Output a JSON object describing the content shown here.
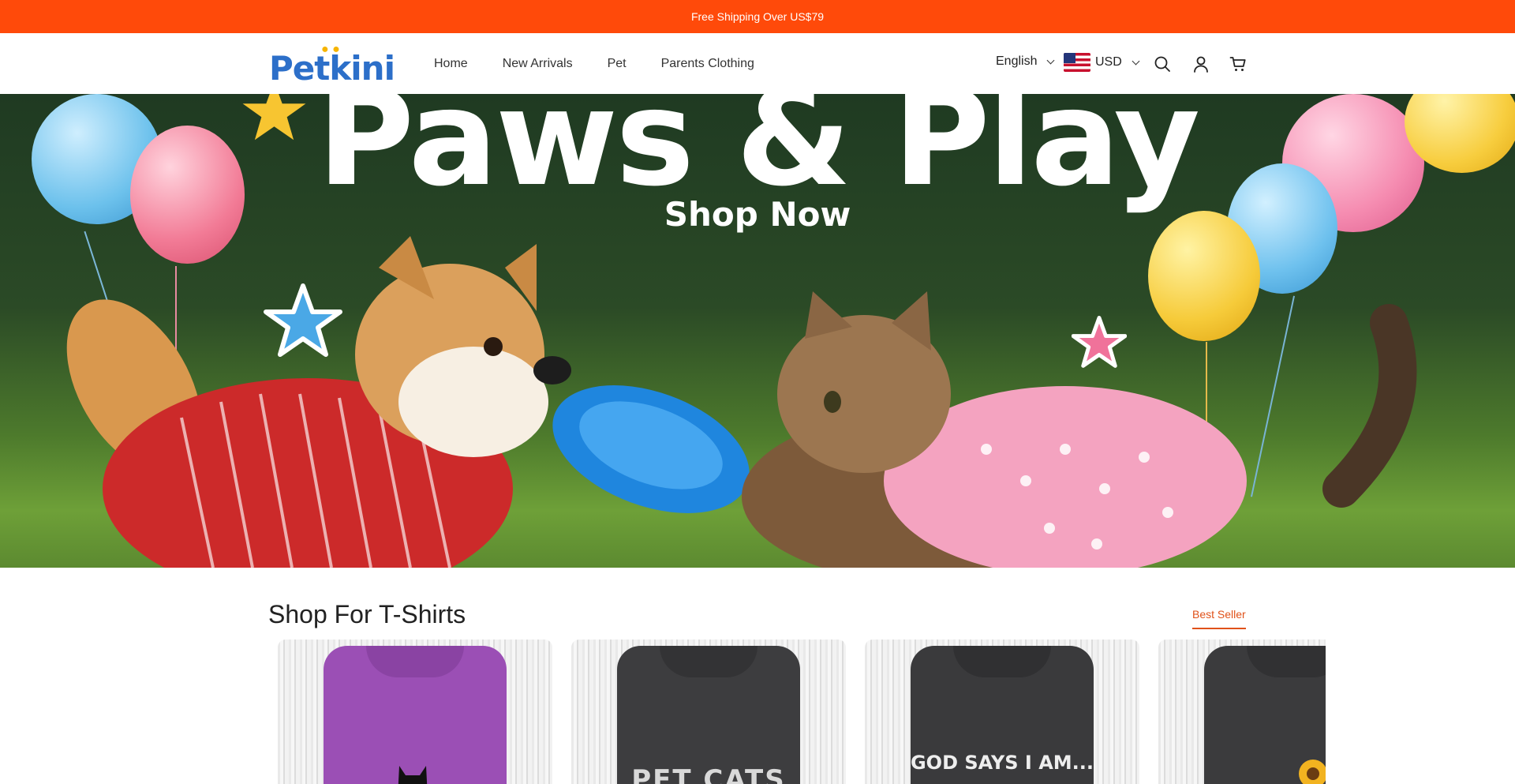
{
  "announcement": {
    "text": "Free Shipping Over US$79"
  },
  "header": {
    "logo_text": "Petkini",
    "nav": [
      "Home",
      "New Arrivals",
      "Pet",
      "Parents Clothing"
    ],
    "language": "English",
    "currency": "USD"
  },
  "hero": {
    "title": "Paws & Play",
    "cta": "Shop Now"
  },
  "section": {
    "title": "Shop For T-Shirts",
    "tab": "Best Seller"
  },
  "products": [
    {
      "color": "#9b4fb5",
      "print": ""
    },
    {
      "color": "#3d3d3f",
      "print": "PET CATS"
    },
    {
      "color": "#3a3a3c",
      "print": "GOD SAYS I AM..."
    },
    {
      "color": "#3b3b3d",
      "print": ""
    }
  ],
  "colors": {
    "accent": "#ff4a0a",
    "brand": "#2c6fc9",
    "tab": "#e0521a"
  }
}
